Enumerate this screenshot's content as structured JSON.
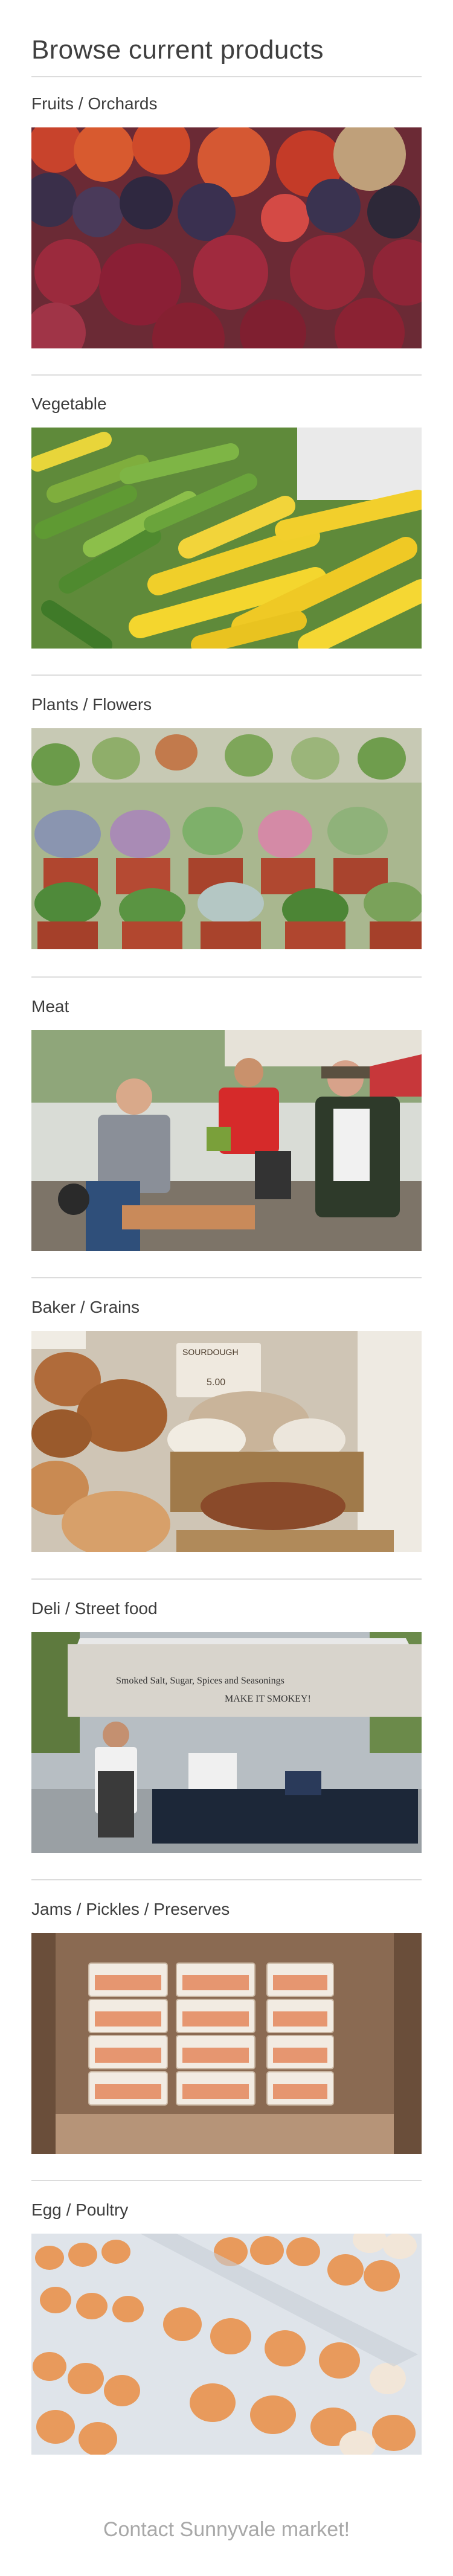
{
  "header": {
    "title": "Browse current products"
  },
  "categories": [
    {
      "id": "fruits",
      "name": "Fruits / Orchards",
      "image_icon": "plums-photo-icon"
    },
    {
      "id": "vegetable",
      "name": "Vegetable",
      "image_icon": "squash-photo-icon"
    },
    {
      "id": "plants",
      "name": "Plants / Flowers",
      "image_icon": "succulents-photo-icon"
    },
    {
      "id": "meat",
      "name": "Meat",
      "image_icon": "market-vendors-photo-icon"
    },
    {
      "id": "baker",
      "name": "Baker / Grains",
      "image_icon": "bread-basket-photo-icon"
    },
    {
      "id": "deli",
      "name": "Deli / Street food",
      "image_icon": "food-tent-photo-icon"
    },
    {
      "id": "jams",
      "name": "Jams / Pickles / Preserves",
      "image_icon": "jars-photo-icon"
    },
    {
      "id": "eggs",
      "name": "Egg / Poultry",
      "image_icon": "egg-cartons-photo-icon"
    }
  ],
  "image_text": {
    "bread_sign": "SOURDOUGH",
    "bread_price": "5.00",
    "deli_banner_line1": "Smoked Salt, Sugar, Spices and Seasonings",
    "deli_banner_line2": "MAKE IT SMOKEY!"
  },
  "footer": {
    "contact_label": "Contact Sunnyvale market!"
  },
  "colors": {
    "rule": "#dcdcdc",
    "contact": "#a8a8a8",
    "title": "#3f3f3f"
  }
}
